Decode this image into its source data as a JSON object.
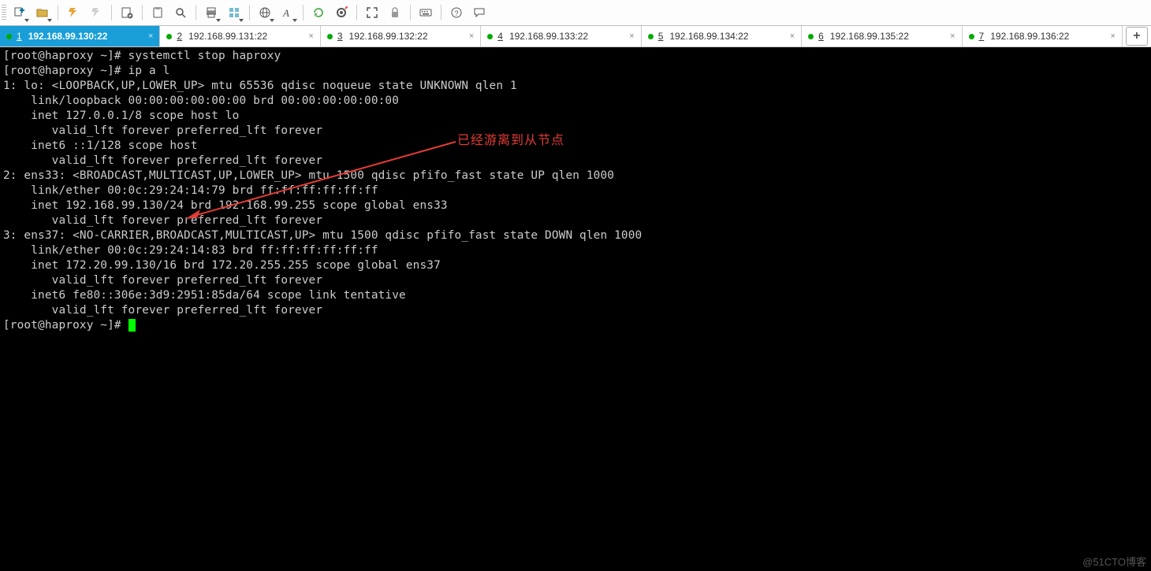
{
  "toolbar": {
    "icons": [
      "new-session-icon",
      "open-icon",
      "",
      "reconnect-icon",
      "copy-session-icon",
      "",
      "settings-icon",
      "",
      "copy-icon",
      "search-icon",
      "",
      "print-icon",
      "layout-icon",
      "",
      "globe-icon",
      "font-icon",
      "",
      "reset-icon",
      "target-icon",
      "",
      "fullscreen-icon",
      "lock-icon",
      "",
      "keyboard-icon",
      "",
      "help-icon",
      "chat-icon"
    ]
  },
  "tabs": [
    {
      "num": "1",
      "label": "192.168.99.130:22",
      "active": true
    },
    {
      "num": "2",
      "label": "192.168.99.131:22",
      "active": false
    },
    {
      "num": "3",
      "label": "192.168.99.132:22",
      "active": false
    },
    {
      "num": "4",
      "label": "192.168.99.133:22",
      "active": false
    },
    {
      "num": "5",
      "label": "192.168.99.134:22",
      "active": false
    },
    {
      "num": "6",
      "label": "192.168.99.135:22",
      "active": false
    },
    {
      "num": "7",
      "label": "192.168.99.136:22",
      "active": false
    }
  ],
  "add_tab": "+",
  "annotation": "已经游离到从节点",
  "terminal_lines": [
    "[root@haproxy ~]# systemctl stop haproxy",
    "[root@haproxy ~]# ip a l",
    "1: lo: <LOOPBACK,UP,LOWER_UP> mtu 65536 qdisc noqueue state UNKNOWN qlen 1",
    "    link/loopback 00:00:00:00:00:00 brd 00:00:00:00:00:00",
    "    inet 127.0.0.1/8 scope host lo",
    "       valid_lft forever preferred_lft forever",
    "    inet6 ::1/128 scope host ",
    "       valid_lft forever preferred_lft forever",
    "2: ens33: <BROADCAST,MULTICAST,UP,LOWER_UP> mtu 1500 qdisc pfifo_fast state UP qlen 1000",
    "    link/ether 00:0c:29:24:14:79 brd ff:ff:ff:ff:ff:ff",
    "    inet 192.168.99.130/24 brd 192.168.99.255 scope global ens33",
    "       valid_lft forever preferred_lft forever",
    "3: ens37: <NO-CARRIER,BROADCAST,MULTICAST,UP> mtu 1500 qdisc pfifo_fast state DOWN qlen 1000",
    "    link/ether 00:0c:29:24:14:83 brd ff:ff:ff:ff:ff:ff",
    "    inet 172.20.99.130/16 brd 172.20.255.255 scope global ens37",
    "       valid_lft forever preferred_lft forever",
    "    inet6 fe80::306e:3d9:2951:85da/64 scope link tentative ",
    "       valid_lft forever preferred_lft forever"
  ],
  "prompt": "[root@haproxy ~]# ",
  "watermark": "@51CTO博客"
}
